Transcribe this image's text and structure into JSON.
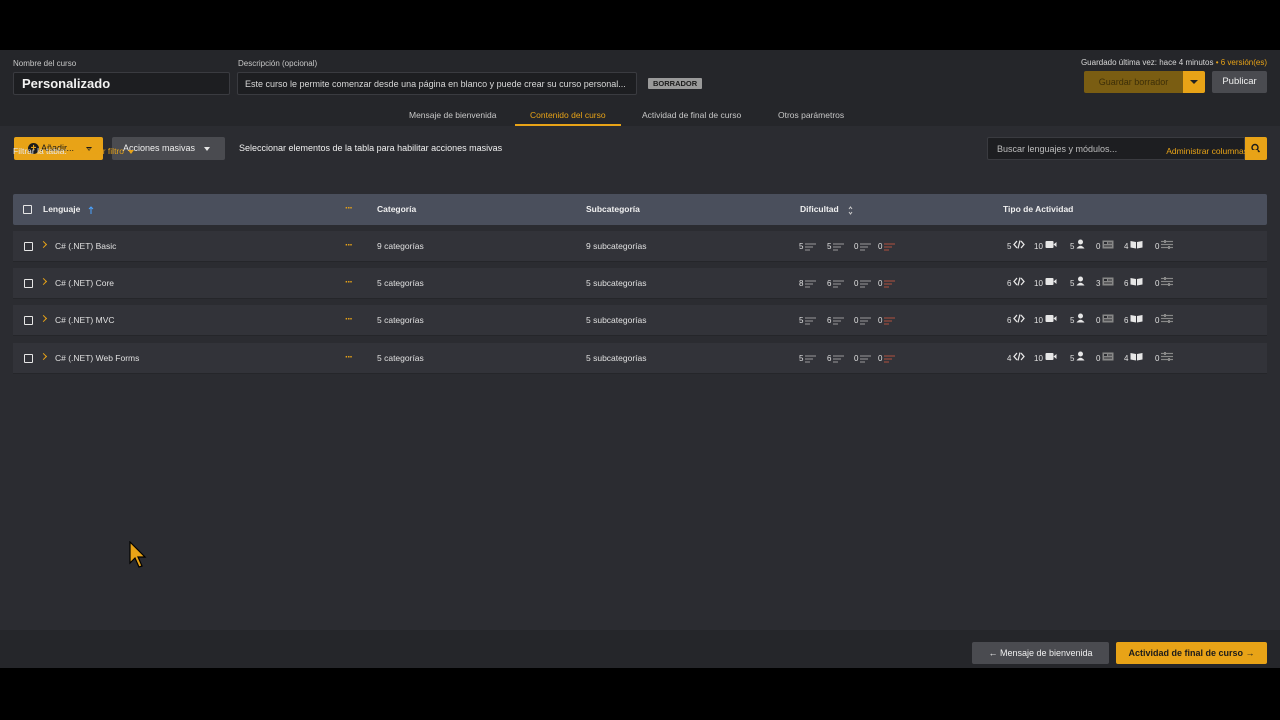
{
  "header": {
    "course_name_label": "Nombre del curso",
    "course_name": "Personalizado",
    "description_label": "Descripción (opcional)",
    "description": "Este curso le permite comenzar desde una página en blanco y puede crear su curso personal...",
    "status_badge": "BORRADOR",
    "saved_text": "Guardado última vez: hace 4 minutos",
    "saved_sep": "•",
    "versions_link": "6 versión(es)",
    "save_draft_label": "Guardar borrador",
    "publish_label": "Publicar"
  },
  "tabs": [
    {
      "label": "Mensaje de bienvenida",
      "active": false
    },
    {
      "label": "Contenido del curso",
      "active": true
    },
    {
      "label": "Actividad de final de curso",
      "active": false
    },
    {
      "label": "Otros parámetros",
      "active": false
    }
  ],
  "toolbar": {
    "add_label": "Añadir...",
    "mass_actions_label": "Acciones masivas",
    "mass_hint": "Seleccionar elementos de la tabla para habilitar acciones masivas",
    "search_placeholder": "Buscar lenguajes y módulos...",
    "filter_label": "Filtrar la tabla:",
    "add_filter_label": "Añadir filtro",
    "manage_columns_label": "Administrar columnas"
  },
  "table": {
    "columns": [
      "Lenguaje",
      "Categoría",
      "Subcategoría",
      "Dificultad",
      "Tipo de Actividad"
    ],
    "rows": [
      {
        "language": "C# (.NET) Basic",
        "categories": "9 categorías",
        "subcategories": "9 subcategorías",
        "difficulty": [
          "5",
          "5",
          "0",
          "0"
        ],
        "activity": [
          "5",
          "10",
          "5",
          "0",
          "4",
          "0"
        ]
      },
      {
        "language": "C# (.NET) Core",
        "categories": "5 categorías",
        "subcategories": "5 subcategorías",
        "difficulty": [
          "8",
          "6",
          "0",
          "0"
        ],
        "activity": [
          "6",
          "10",
          "5",
          "3",
          "6",
          "0"
        ]
      },
      {
        "language": "C# (.NET) MVC",
        "categories": "5 categorías",
        "subcategories": "5 subcategorías",
        "difficulty": [
          "5",
          "6",
          "0",
          "0"
        ],
        "activity": [
          "6",
          "10",
          "5",
          "0",
          "6",
          "0"
        ]
      },
      {
        "language": "C# (.NET) Web Forms",
        "categories": "5 categorías",
        "subcategories": "5 subcategorías",
        "difficulty": [
          "5",
          "6",
          "0",
          "0"
        ],
        "activity": [
          "4",
          "10",
          "5",
          "0",
          "4",
          "0"
        ]
      }
    ]
  },
  "footer": {
    "prev_label": "Mensaje de bienvenida",
    "next_label": "Actividad de final de curso"
  },
  "colors": {
    "accent": "#e8a317",
    "background": "#2b2c31",
    "header_row": "#4a4f5c"
  }
}
